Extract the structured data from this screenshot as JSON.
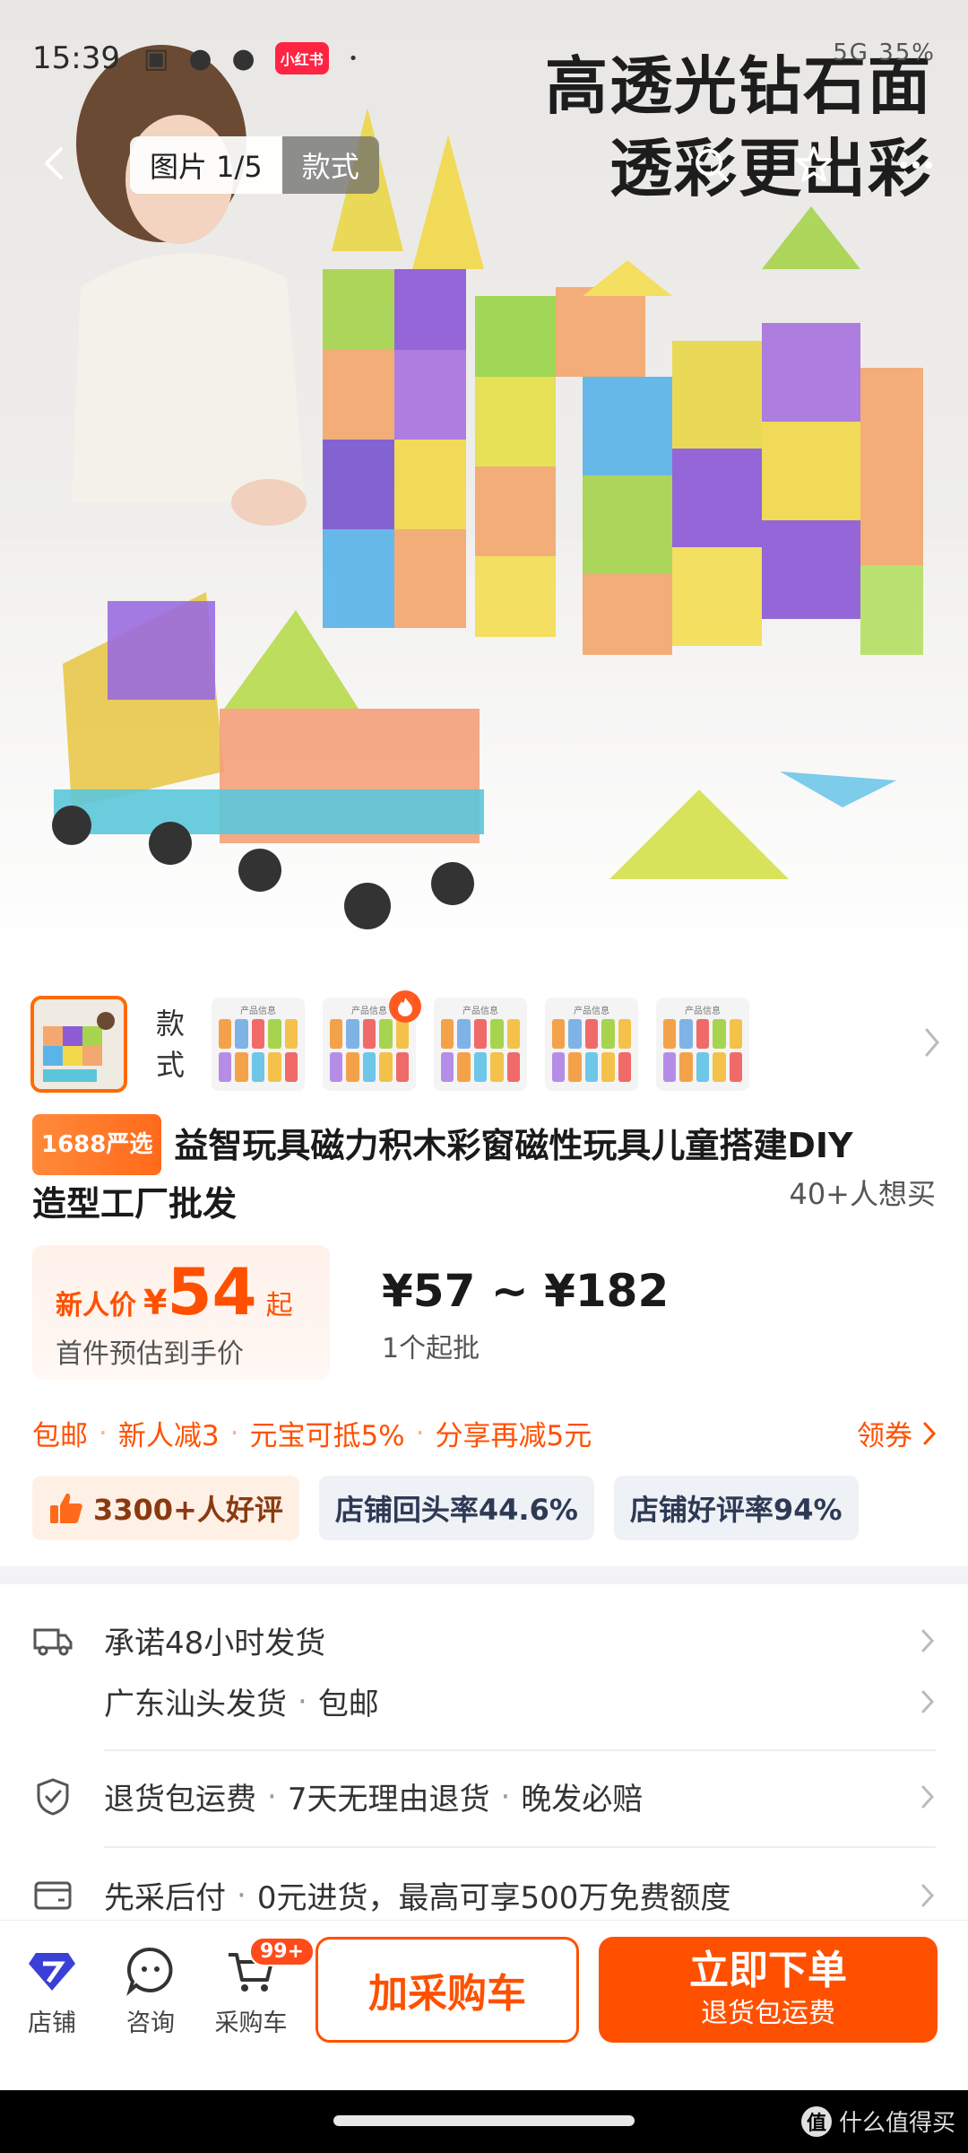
{
  "status_bar": {
    "time": "15:39",
    "app_icon_label": "小红书",
    "right_text": "5G 35%"
  },
  "hero": {
    "headline_line1": "高透光钻石面",
    "headline_line2": "透彩更出彩",
    "tabs": [
      {
        "label": "图片 1/5",
        "active": true
      },
      {
        "label": "款式",
        "active": false
      }
    ]
  },
  "style_picker": {
    "label_line1": "款",
    "label_line2": "式",
    "thumb_title": "产品信息",
    "thumb_count": 5
  },
  "product": {
    "badge": "1688严选",
    "title_line1": "益智玩具磁力积木彩窗磁性玩具儿童搭建DIY",
    "title_line2": "造型工厂批发",
    "want_count": "40+人想买"
  },
  "price": {
    "new_user_label": "新人价",
    "currency": "¥",
    "new_user_price": "54",
    "unit_suffix": "起",
    "estimate_note": "首件预估到手价",
    "range": "¥57 ~ ¥182",
    "moq": "1个起批"
  },
  "promo": {
    "items": [
      "包邮",
      "新人减3",
      "元宝可抵5%",
      "分享再减5元"
    ],
    "coupon_label": "领券"
  },
  "stats": {
    "good_reviews": "3300+人好评",
    "repurchase": "店铺回头率44.6%",
    "positive_rate": "店铺好评率94%"
  },
  "services": {
    "ship_promise": "承诺48小时发货",
    "ship_from": "广东汕头发货",
    "ship_free": "包邮",
    "returns_1": "退货包运费",
    "returns_2": "7天无理由退货",
    "returns_3": "晚发必赔",
    "pay_1": "先采后付",
    "pay_2": "0元进货，最高可享500万免费额度"
  },
  "bottom_bar": {
    "store": "店铺",
    "consult": "咨询",
    "cart": "采购车",
    "cart_badge": "99+",
    "add_to_cart": "加采购车",
    "buy_now": "立即下单",
    "buy_now_sub": "退货包运费"
  },
  "watermark": {
    "text": "什么值得买",
    "logo": "值"
  },
  "colors": {
    "accent": "#ff5000",
    "badge_orange": "#ff7a1a",
    "stat_bg": "#eef1f6"
  }
}
